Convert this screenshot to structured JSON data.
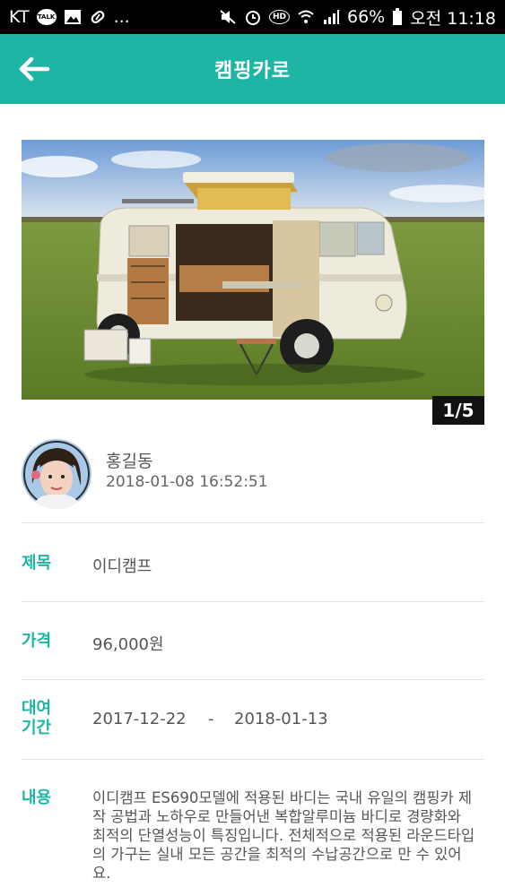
{
  "status_bar": {
    "carrier": "KT",
    "ellipsis": "...",
    "battery": "66%",
    "time": "오전 11:18",
    "talk_badge": "TALK",
    "hd_badge": "HD"
  },
  "app_bar": {
    "title": "캠핑카로",
    "back_icon": "arrow-left-icon"
  },
  "photo": {
    "counter": "1/5",
    "current": 1,
    "total": 5
  },
  "author": {
    "name": "홍길동",
    "datetime": "2018-01-08 16:52:51"
  },
  "fields": {
    "title_label": "제목",
    "title_value": "이디캠프",
    "price_label": "가격",
    "price_value": "96,000원",
    "rental_label_line1": "대여",
    "rental_label_line2": "기간",
    "rental_start": "2017-12-22",
    "rental_separator": "-",
    "rental_end": "2018-01-13",
    "content_label": "내용",
    "content_value": "이디캠프 ES690모델에 적용된 바디는 국내 유일의 캠핑카 제작 공법과 노하우로 만들어낸 복합알루미늄 바디로 경량화와 최적의 단열성능이 특징입니다. 전체적으로 적용된 라운드타입의 가구는 실내 모든 공간을 최적의 수납공간으로 만 수 있어요."
  },
  "colors": {
    "accent": "#1db5a3",
    "status_bar": "#000000",
    "text": "#555555",
    "divider": "#e3e3e3"
  }
}
